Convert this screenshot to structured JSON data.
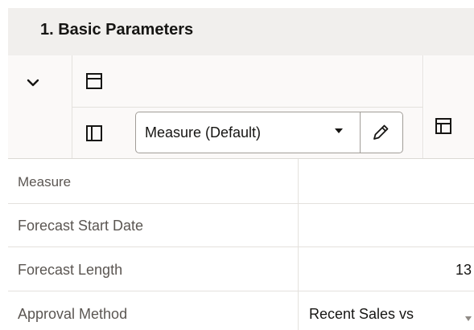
{
  "section": {
    "title": "1. Basic Parameters"
  },
  "toolbar": {
    "collapse_icon": "chevron-down-icon",
    "top_panel_icon": "panel-top-icon",
    "left_panel_icon": "panel-left-icon",
    "pane_icon": "pane-layout-icon",
    "measure_select": {
      "selected": "Measure (Default)"
    },
    "edit_icon": "pencil-icon"
  },
  "table": {
    "rows": [
      {
        "label": "Measure",
        "value": ""
      },
      {
        "label": "Forecast Start Date",
        "value": ""
      },
      {
        "label": "Forecast Length",
        "value": "13"
      },
      {
        "label": "Approval Method",
        "value": "Recent Sales vs"
      }
    ]
  },
  "colors": {
    "header_bg": "#f1efed",
    "toolbar_bg": "#fbf9f8",
    "border": "#e4e1dd",
    "text": "#161513",
    "label_text": "#5b5652"
  }
}
